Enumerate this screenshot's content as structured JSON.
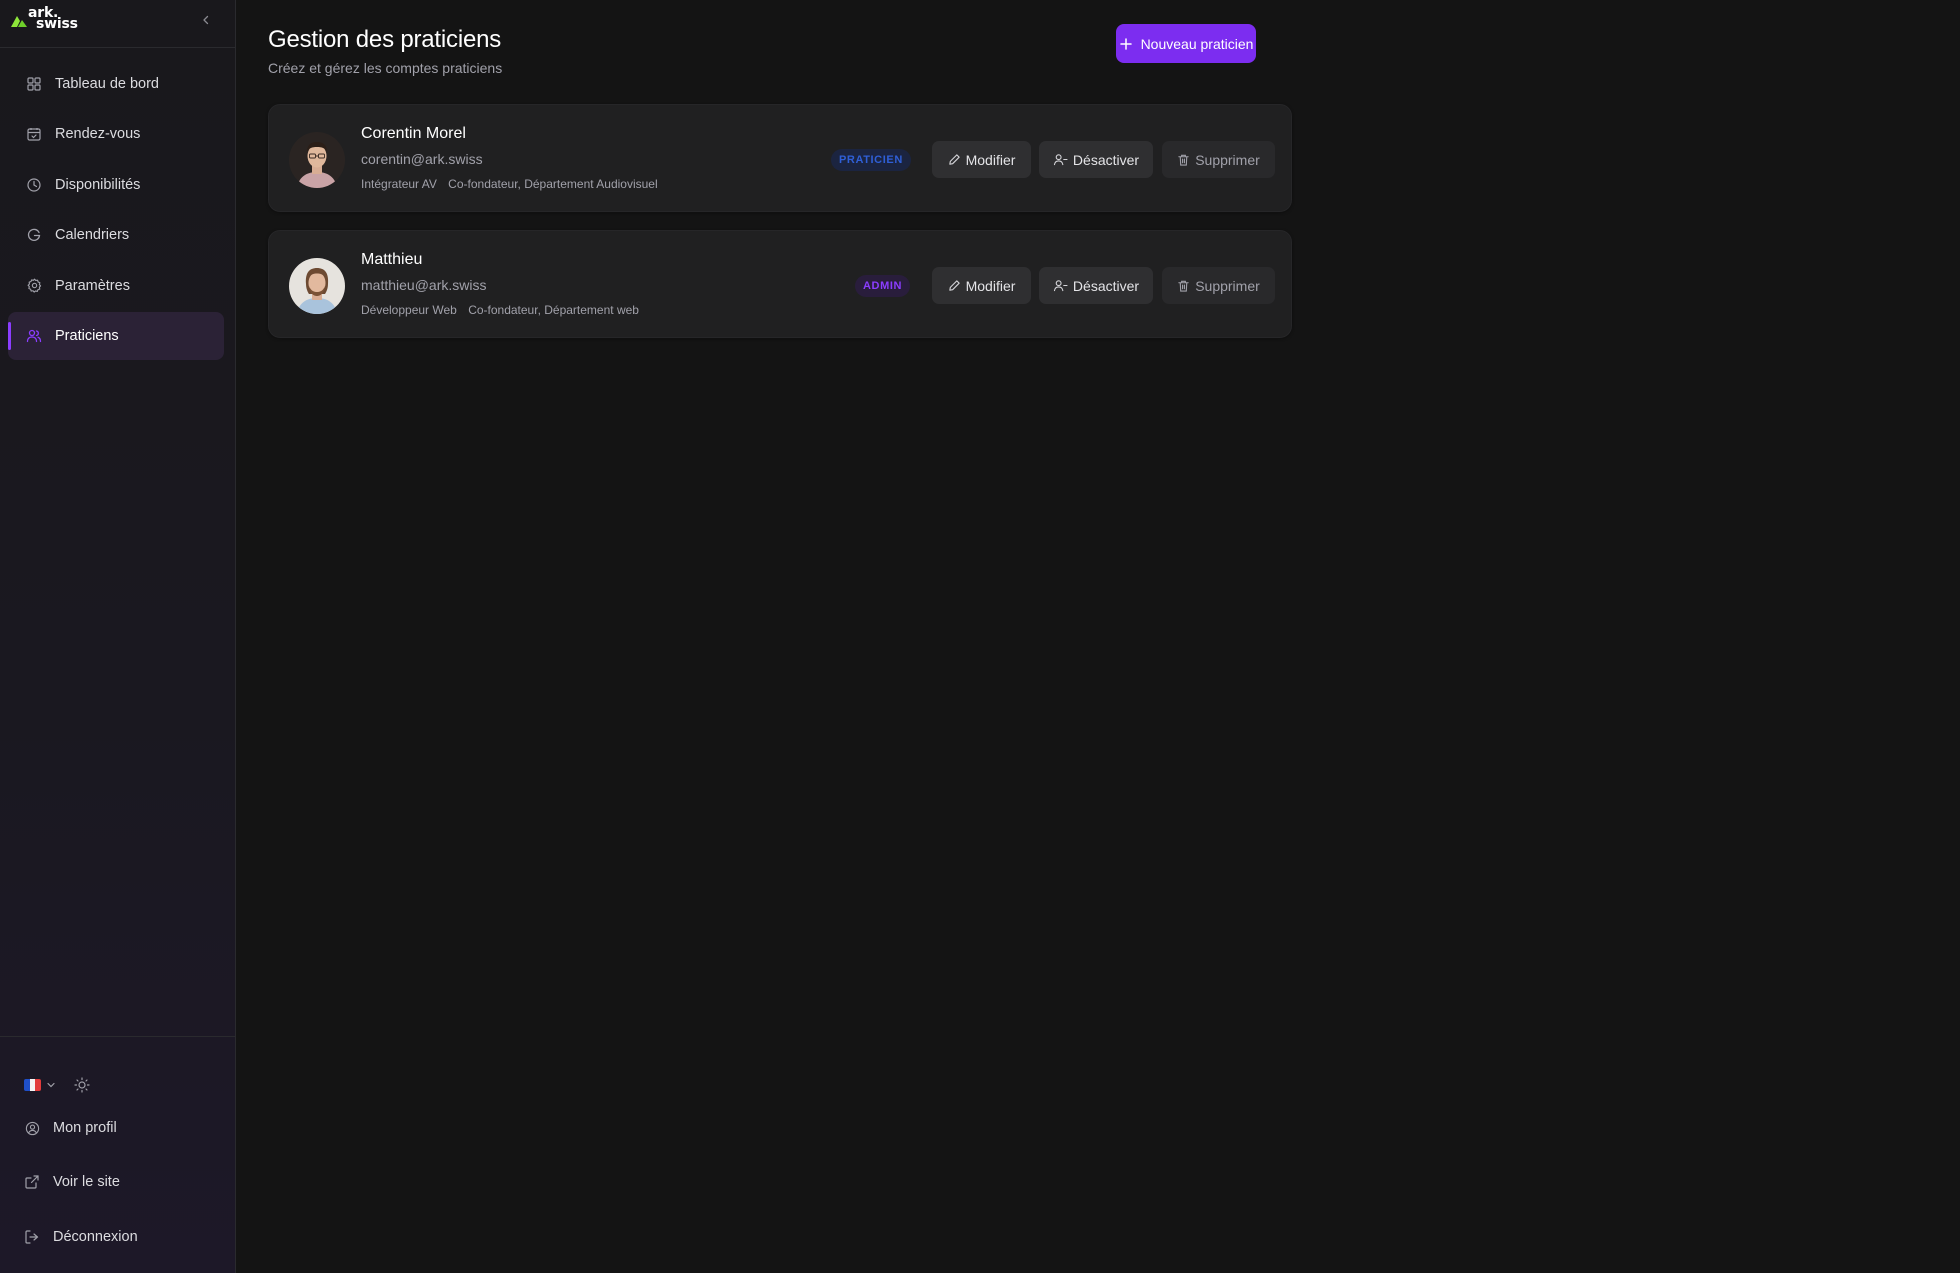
{
  "brand": {
    "logo_line1": "ark.",
    "logo_line2": "swiss"
  },
  "sidebar": {
    "items": [
      {
        "label": "Tableau de bord",
        "icon": "dashboard-grid-icon",
        "active": false
      },
      {
        "label": "Rendez-vous",
        "icon": "calendar-check-icon",
        "active": false
      },
      {
        "label": "Disponibilités",
        "icon": "clock-icon",
        "active": false
      },
      {
        "label": "Calendriers",
        "icon": "google-calendar-icon",
        "active": false
      },
      {
        "label": "Paramètres",
        "icon": "gear-icon",
        "active": false
      },
      {
        "label": "Praticiens",
        "icon": "users-icon",
        "active": true
      }
    ],
    "language": "FR",
    "bottom": [
      {
        "label": "Mon profil",
        "icon": "user-circle-icon"
      },
      {
        "label": "Voir le site",
        "icon": "external-link-icon"
      },
      {
        "label": "Déconnexion",
        "icon": "logout-icon"
      }
    ]
  },
  "header": {
    "title": "Gestion des praticiens",
    "subtitle": "Créez et gérez les comptes praticiens",
    "new_button": "Nouveau praticien"
  },
  "practitioners": [
    {
      "name": "Corentin Morel",
      "email": "corentin@ark.swiss",
      "role": "Intégrateur AV",
      "description": "Co-fondateur, Département Audiovisuel",
      "badge": "PRATICIEN"
    },
    {
      "name": "Matthieu",
      "email": "matthieu@ark.swiss",
      "role": "Développeur Web",
      "description": "Co-fondateur, Département web",
      "badge": "ADMIN"
    }
  ],
  "actions": {
    "modify": "Modifier",
    "deactivate": "Désactiver",
    "delete": "Supprimer"
  },
  "colors": {
    "accent": "#7c2df0",
    "active_indicator": "#8b3dff",
    "badge_praticien": "#2f5fd6",
    "badge_admin": "#8b3dff",
    "background": "#141414"
  }
}
